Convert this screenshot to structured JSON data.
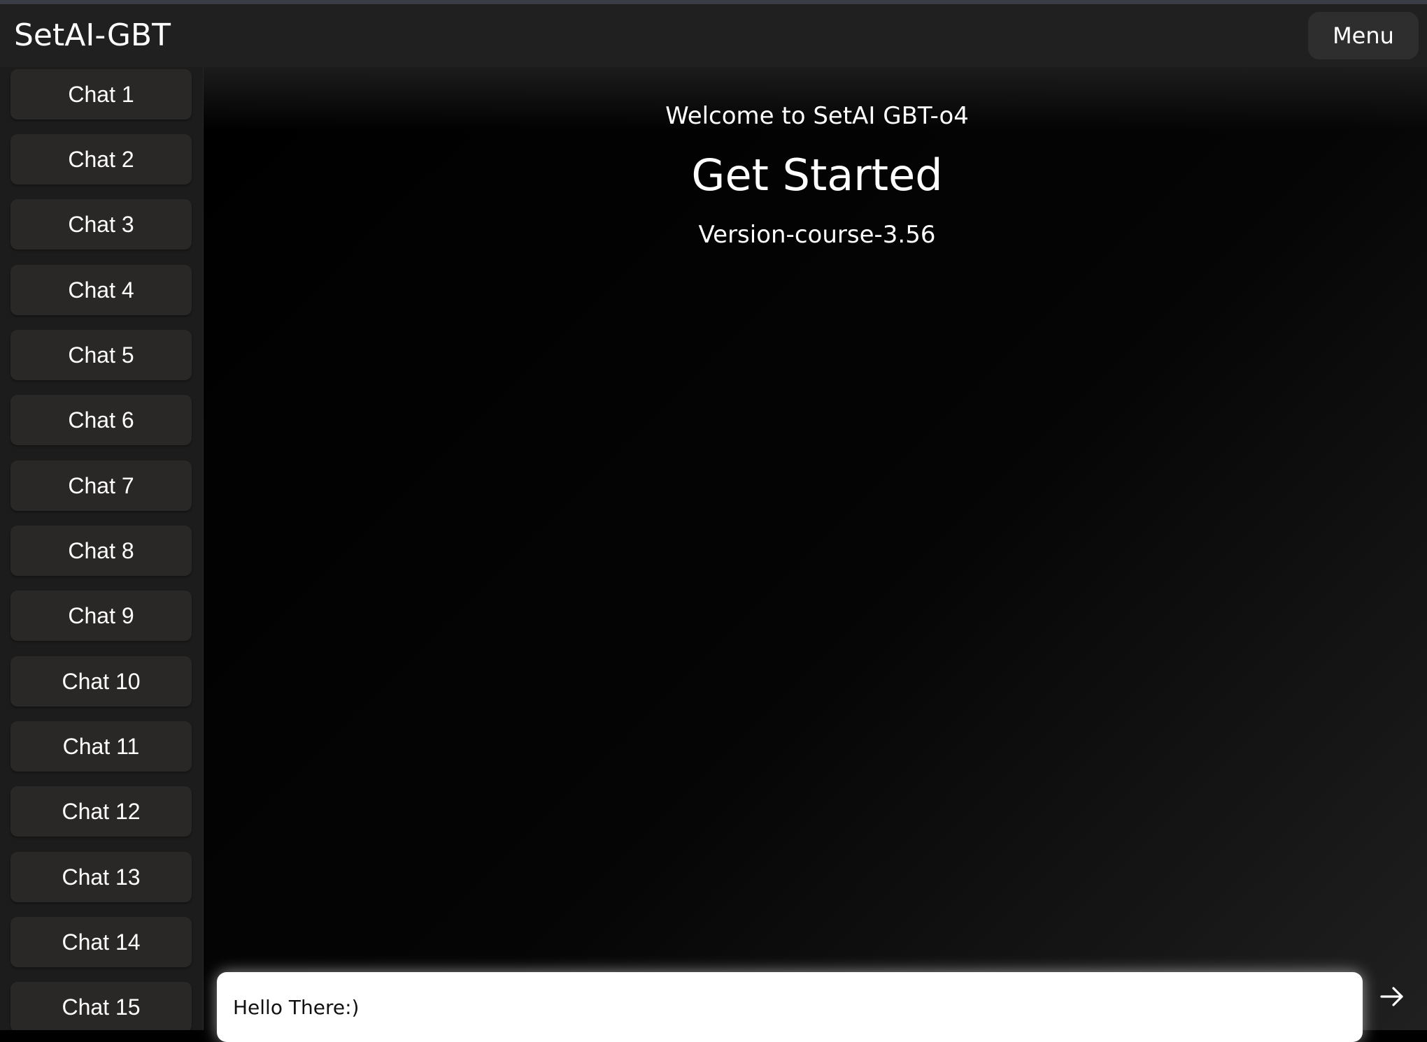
{
  "header": {
    "title": "SetAI-GBT",
    "menu_label": "Menu"
  },
  "sidebar": {
    "items": [
      {
        "label": "Chat 1"
      },
      {
        "label": "Chat 2"
      },
      {
        "label": "Chat 3"
      },
      {
        "label": "Chat 4"
      },
      {
        "label": "Chat 5"
      },
      {
        "label": "Chat 6"
      },
      {
        "label": "Chat 7"
      },
      {
        "label": "Chat 8"
      },
      {
        "label": "Chat 9"
      },
      {
        "label": "Chat 10"
      },
      {
        "label": "Chat 11"
      },
      {
        "label": "Chat 12"
      },
      {
        "label": "Chat 13"
      },
      {
        "label": "Chat 14"
      },
      {
        "label": "Chat 15"
      }
    ]
  },
  "main": {
    "welcome": "Welcome to SetAI GBT-o4",
    "heading": "Get Started",
    "version": "Version-course-3.56"
  },
  "input": {
    "value": "Hello There:)",
    "send_icon": "arrow-right-icon"
  },
  "colors": {
    "background": "#000000",
    "header": "#202020",
    "sidebar": "#1c1c1c",
    "chat_item": "#2a2827",
    "menu_button": "#2e2e2e",
    "input": "#ffffff"
  }
}
